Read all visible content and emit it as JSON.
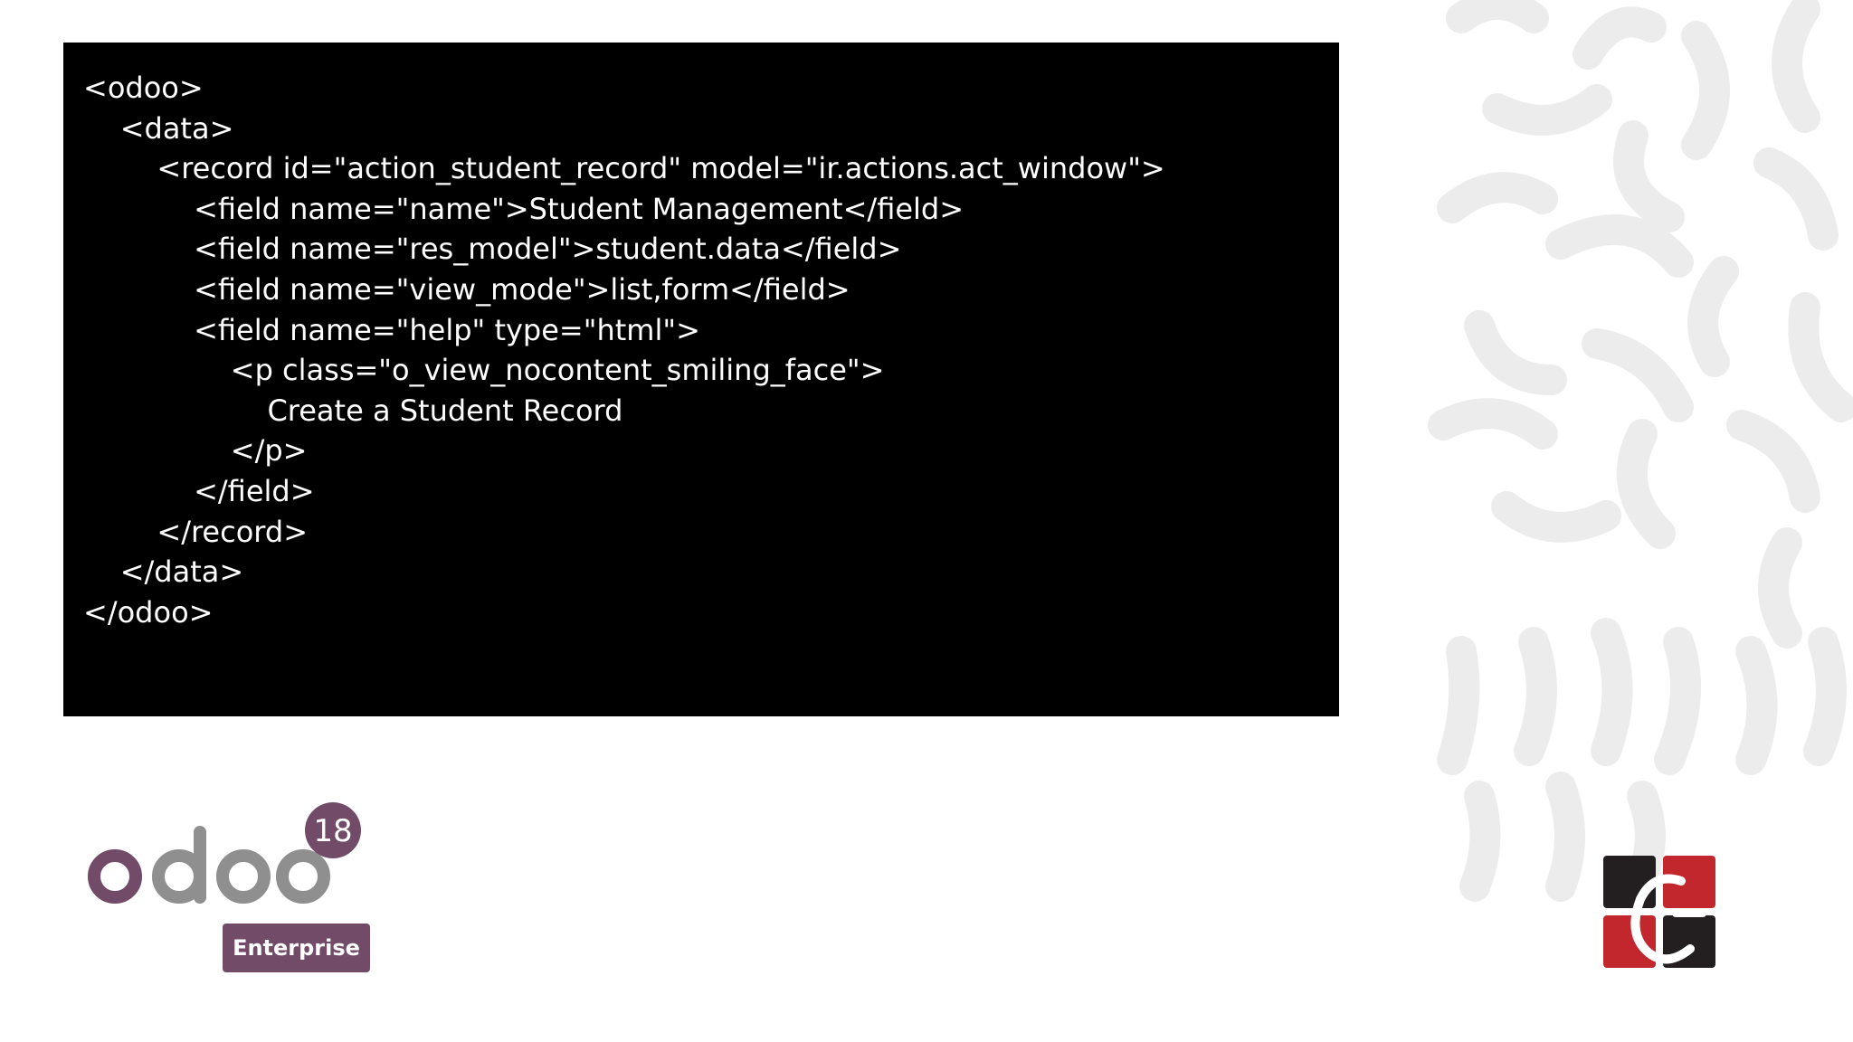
{
  "code": {
    "lines": [
      "<odoo>",
      "    <data>",
      "        <record id=\"action_student_record\" model=\"ir.actions.act_window\">",
      "            <field name=\"name\">Student Management</field>",
      "            <field name=\"res_model\">student.data</field>",
      "            <field name=\"view_mode\">list,form</field>",
      "            <field name=\"help\" type=\"html\">",
      "                <p class=\"o_view_nocontent_smiling_face\">",
      "                    Create a Student Record",
      "                </p>",
      "            </field>",
      "        </record>",
      "    </data>",
      "</odoo>"
    ]
  },
  "logo": {
    "wordmark": "odoo",
    "version": "18",
    "edition": "Enterprise",
    "colors": {
      "brand_purple": "#714b67",
      "brand_gray": "#8f8f8f"
    }
  },
  "company_logo": {
    "icon": "ce-monogram-icon",
    "colors": {
      "dark": "#231f20",
      "red": "#c1272d"
    }
  }
}
